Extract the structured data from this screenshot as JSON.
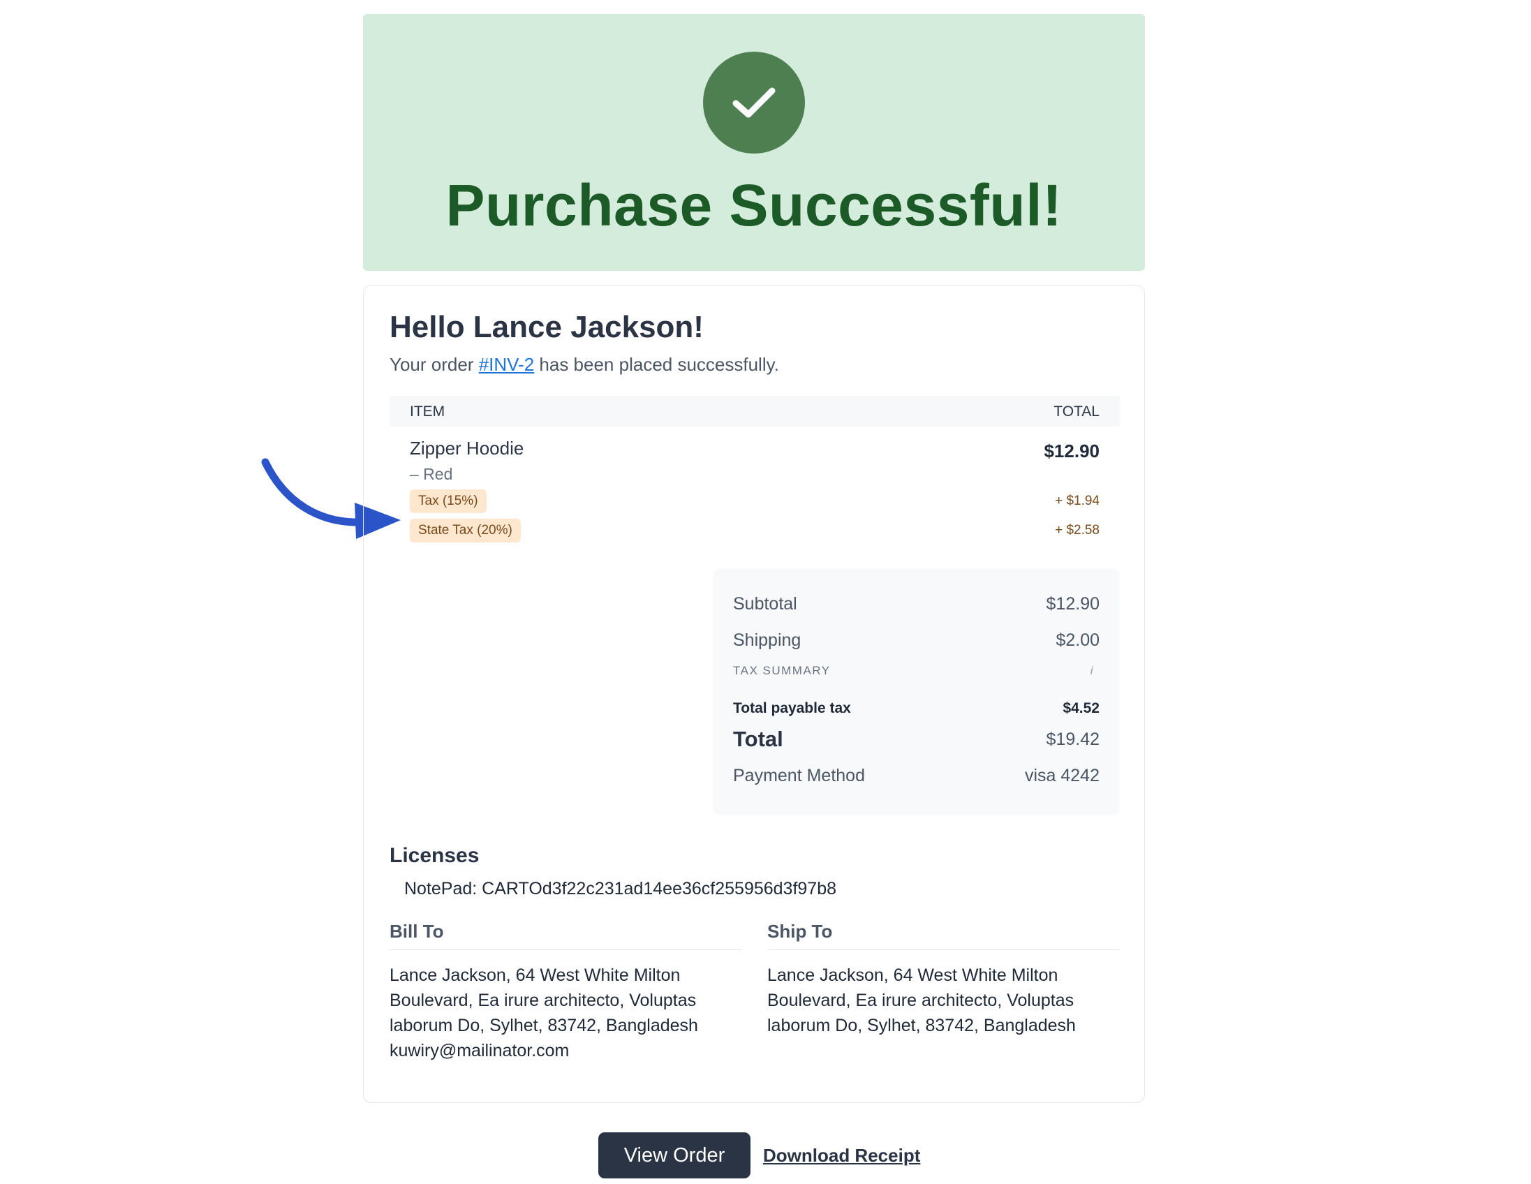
{
  "hero": {
    "title": "Purchase Successful!"
  },
  "greeting": "Hello Lance Jackson!",
  "order_message": {
    "prefix": "Your order ",
    "order_id": "#INV-2",
    "suffix": " has been placed successfully."
  },
  "items_table": {
    "headers": {
      "item": "ITEM",
      "total": "TOTAL"
    },
    "items": [
      {
        "name": "Zipper Hoodie",
        "variant": "– Red",
        "price": "$12.90",
        "taxes": [
          {
            "label": "Tax (15%)",
            "amount": "+ $1.94"
          },
          {
            "label": "State Tax (20%)",
            "amount": "+ $2.58"
          }
        ]
      }
    ]
  },
  "summary": {
    "subtotal_label": "Subtotal",
    "subtotal_value": "$12.90",
    "shipping_label": "Shipping",
    "shipping_value": "$2.00",
    "tax_summary_label": "TAX SUMMARY",
    "tax_info_glyph": "i",
    "payable_tax_label": "Total payable tax",
    "payable_tax_value": "$4.52",
    "total_label": "Total",
    "total_value": "$19.42",
    "payment_label": "Payment Method",
    "payment_value": "visa 4242"
  },
  "licenses": {
    "title": "Licenses",
    "line": "NotePad: CARTOd3f22c231ad14ee36cf255956d3f97b8"
  },
  "bill_to": {
    "title": "Bill To",
    "address": "Lance Jackson, 64 West White Milton Boulevard, Ea irure architecto, Voluptas laborum Do, Sylhet, 83742, Bangladesh",
    "email": "kuwiry@mailinator.com"
  },
  "ship_to": {
    "title": "Ship To",
    "address": "Lance Jackson, 64 West White Milton Boulevard, Ea irure architecto, Voluptas laborum Do, Sylhet, 83742, Bangladesh"
  },
  "actions": {
    "view_order": "View Order",
    "download_receipt": "Download Receipt"
  },
  "colors": {
    "hero_bg": "#d4ecdb",
    "check_circle": "#4e7f51",
    "hero_title": "#1c5a28",
    "link": "#1d74d9",
    "tax_badge_bg": "#fde7cf",
    "arrow": "#2a54c8",
    "button_bg": "#2b3444"
  },
  "icons": {
    "success": "check-icon",
    "annotation": "curved-arrow-icon",
    "info": "info-icon"
  }
}
